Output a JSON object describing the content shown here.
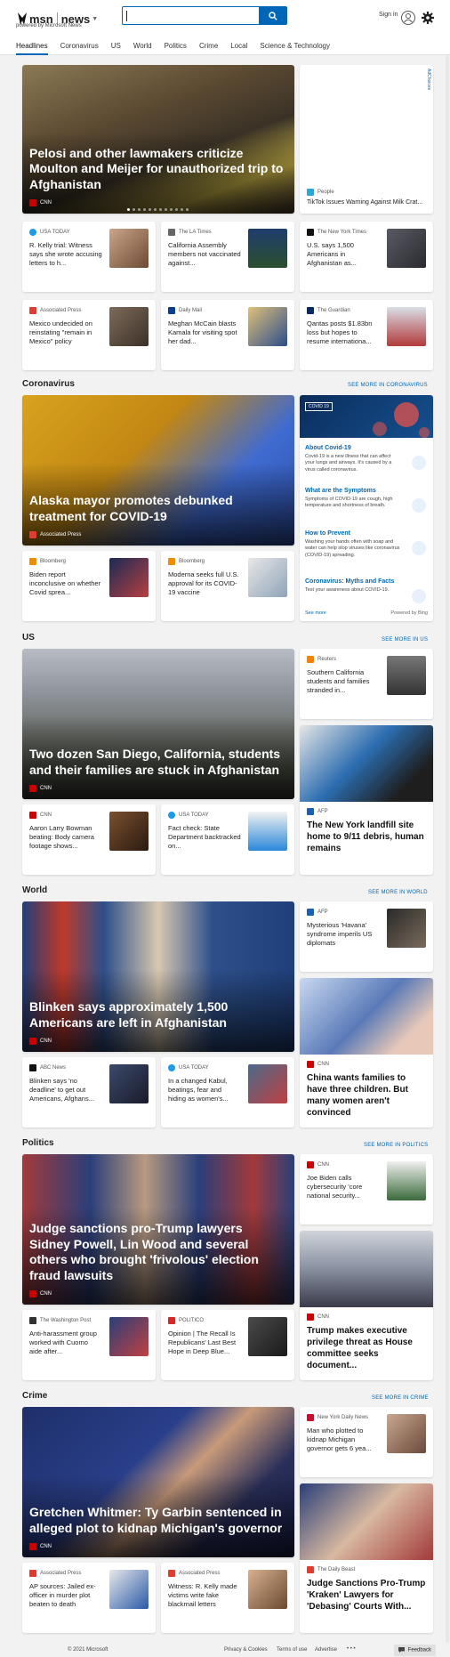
{
  "header": {
    "brand": "msn",
    "channel": "news",
    "powered_by": "powered by Microsoft News",
    "search": {
      "placeholder": "",
      "value": ""
    },
    "sign_in": "Sign in",
    "accent_color": "#0067b8"
  },
  "nav": {
    "items": [
      "Headlines",
      "Coronavirus",
      "US",
      "World",
      "Politics",
      "Crime",
      "Local",
      "Science & Technology"
    ],
    "active": "Headlines"
  },
  "ad_label": "AdChoices",
  "headlines": {
    "hero": {
      "title": "Pelosi and other lawmakers criticize Moulton and Meijer for unauthorized trip to Afghanistan",
      "source": "CNN"
    },
    "side": {
      "source": "People",
      "title": "TikTok Issues Warning Against Milk Crat..."
    },
    "cards": [
      {
        "source": "USA TODAY",
        "title": "R. Kelly trial: Witness says she wrote accusing letters to h..."
      },
      {
        "source": "The LA Times",
        "title": "California Assembly members not vaccinated against..."
      },
      {
        "source": "The New York Times",
        "title": "U.S. says 1,500 Americans in Afghanistan as..."
      },
      {
        "source": "Associated Press",
        "title": "Mexico undecided on reinstating \"remain in Mexico\" policy"
      },
      {
        "source": "Daily Mail",
        "title": "Meghan McCain blasts Kamala for visiting spot her dad..."
      },
      {
        "source": "The Guardian",
        "title": "Qantas posts $1.83bn loss but hopes to resume internationa..."
      }
    ]
  },
  "coronavirus": {
    "title": "Coronavirus",
    "see_more": "SEE MORE IN CORONAVIRUS",
    "hero": {
      "title": "Alaska mayor promotes debunked treatment for COVID-19",
      "source": "Associated Press"
    },
    "cards": [
      {
        "source": "Bloomberg",
        "title": "Biden report inconclusive on whether Covid sprea..."
      },
      {
        "source": "Bloomberg",
        "title": "Moderna seeks full U.S. approval for its COVID-19 vaccine"
      }
    ],
    "panel": {
      "tag": "COVID 19",
      "items": [
        {
          "heading": "About Covid-19",
          "text": "Covid-19 is a new illness that can affect your lungs and airways. It's caused by a virus called coronavirus."
        },
        {
          "heading": "What are the Symptoms",
          "text": "Symptoms of COVID-19 are cough, high temperature and shortness of breath."
        },
        {
          "heading": "How to Prevent",
          "text": "Washing your hands often with soap and water can help stop viruses like coronavirus (COVID-19) spreading."
        },
        {
          "heading": "Coronavirus: Myths and Facts",
          "text": "Test your awareness about COVID-19."
        }
      ],
      "see_more": "See more",
      "powered": "Powered by Bing"
    }
  },
  "us": {
    "title": "US",
    "see_more": "SEE MORE IN US",
    "hero": {
      "title": "Two dozen San Diego, California, students and their families are stuck in Afghanistan",
      "source": "CNN"
    },
    "top_right": {
      "source": "Reuters",
      "title": "Southern California students and families stranded in..."
    },
    "side": {
      "source": "AFP",
      "title": "The New York landfill site home to 9/11 debris, human remains"
    },
    "cards": [
      {
        "source": "CNN",
        "title": "Aaron Larry Bowman beating: Body camera footage shows..."
      },
      {
        "source": "USA TODAY",
        "title": "Fact check: State Department backtracked on..."
      }
    ]
  },
  "world": {
    "title": "World",
    "see_more": "SEE MORE IN WORLD",
    "hero": {
      "title": "Blinken says approximately 1,500 Americans are left in Afghanistan",
      "source": "CNN"
    },
    "top_right": {
      "source": "AFP",
      "title": "Mysterious 'Havana' syndrome imperils US diplomats"
    },
    "side": {
      "source": "CNN",
      "title": "China wants families to have three children. But many women aren't convinced"
    },
    "cards": [
      {
        "source": "ABC News",
        "title": "Blinken says 'no deadline' to get out Americans, Afghans..."
      },
      {
        "source": "USA TODAY",
        "title": "In a changed Kabul, beatings, fear and hiding as women's..."
      }
    ]
  },
  "politics": {
    "title": "Politics",
    "see_more": "SEE MORE IN POLITICS",
    "hero": {
      "title": "Judge sanctions pro-Trump lawyers Sidney Powell, Lin Wood and several others who brought 'frivolous' election fraud lawsuits",
      "source": "CNN"
    },
    "top_right": {
      "source": "CNN",
      "title": "Joe Biden calls cybersecurity 'core national security..."
    },
    "side": {
      "source": "CNN",
      "title": "Trump makes executive privilege threat as House committee seeks document..."
    },
    "cards": [
      {
        "source": "The Washington Post",
        "title": "Anti-harassment group worked with Cuomo aide after..."
      },
      {
        "source": "POLITICO",
        "title": "Opinion | The Recall Is Republicans' Last Best Hope in Deep Blue..."
      }
    ]
  },
  "crime": {
    "title": "Crime",
    "see_more": "SEE MORE IN CRIME",
    "hero": {
      "title": "Gretchen Whitmer: Ty Garbin sentenced in alleged plot to kidnap Michigan's governor",
      "source": "CNN"
    },
    "top_right": {
      "source": "New York Daily News",
      "title": "Man who plotted to kidnap Michigan governor gets 6 yea..."
    },
    "side": {
      "source": "The Daily Beast",
      "title": "Judge Sanctions Pro-Trump 'Kraken' Lawyers for 'Debasing' Courts With..."
    },
    "cards": [
      {
        "source": "Associated Press",
        "title": "AP sources: Jailed ex-officer in murder plot beaten to death"
      },
      {
        "source": "Associated Press",
        "title": "Witness: R. Kelly made victims write fake blackmail letters"
      }
    ]
  },
  "footer": {
    "copyright": "© 2021 Microsoft",
    "links": [
      "Privacy & Cookies",
      "Terms of use",
      "Advertise"
    ],
    "more": "• • •",
    "feedback": "Feedback"
  }
}
